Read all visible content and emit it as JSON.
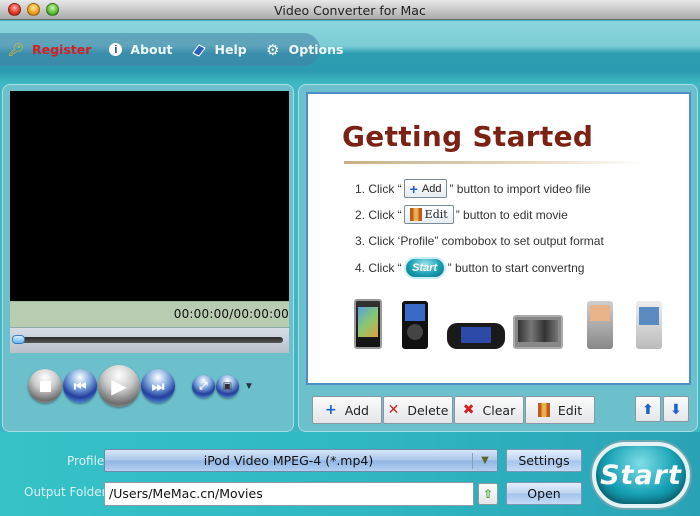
{
  "window": {
    "title": "Video Converter for Mac"
  },
  "menu": {
    "items": [
      {
        "label": "Register",
        "icon": "key-icon"
      },
      {
        "label": "About",
        "icon": "info-icon"
      },
      {
        "label": "Help",
        "icon": "book-icon"
      },
      {
        "label": "Options",
        "icon": "gear-icon"
      }
    ]
  },
  "player": {
    "time": "00:00:00/00:00:00",
    "progress": 0,
    "controls": [
      "stop",
      "previous",
      "play",
      "next",
      "fullscreen",
      "snapshot"
    ]
  },
  "getting_started": {
    "title": "Getting Started",
    "steps": [
      {
        "prefix": "1. Click “",
        "button": "Add",
        "suffix": "” button to import video file"
      },
      {
        "prefix": "2. Click “",
        "button": "Edit",
        "suffix": "” button to edit movie"
      },
      {
        "text": "3. Click ‘Profile” combobox to set output format"
      },
      {
        "prefix": "4. Click “",
        "button": "Start",
        "suffix": "” button to start convertng"
      }
    ],
    "devices": [
      "iPhone",
      "iPod",
      "PSP",
      "Archos",
      "Nokia E-series",
      "Nokia N-series"
    ]
  },
  "toolbar": {
    "add": "Add",
    "delete": "Delete",
    "clear": "Clear",
    "edit": "Edit"
  },
  "output": {
    "profile_label": "Profile",
    "profile_value": "iPod Video MPEG-4 (*.mp4)",
    "folder_label": "Output Folder",
    "folder_value": "/Users/MeMac.cn/Movies",
    "settings_label": "Settings",
    "open_label": "Open",
    "start_label": "Start"
  },
  "colors": {
    "accent": "#2fb8c2",
    "title_red": "#7b2214",
    "register_red": "#d42020"
  }
}
